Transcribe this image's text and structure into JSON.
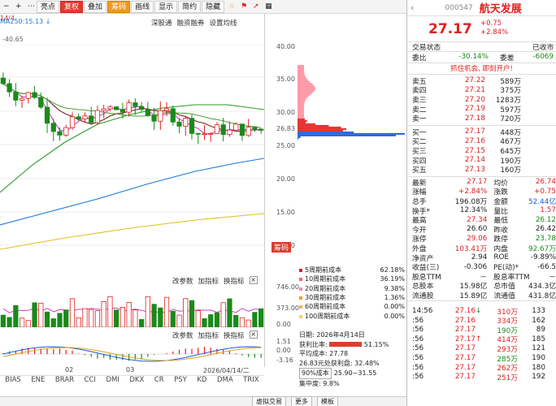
{
  "toolbar": {
    "buttons": [
      "亮点",
      "复权",
      "叠加",
      "筹码",
      "画线",
      "显示",
      "简约",
      "隐藏"
    ],
    "icons": [
      "minus-icon",
      "plus-icon",
      "dots-icon"
    ],
    "topright_icons": [
      "star-icon",
      "flag-icon",
      "arrow-icon",
      "grid-icon"
    ]
  },
  "chart": {
    "topline": "14/4",
    "ma250": "MA250:15.13 ↓",
    "price_low": "-40.65",
    "depth_links": [
      "深股通",
      "融资融券",
      "设置均线"
    ],
    "price_axis": [
      "40.00",
      "35.00",
      "30.00",
      "26.83",
      "25.00",
      "20.00",
      "15.00",
      "10.00"
    ],
    "chips_btn": "筹码",
    "vol_header": [
      "改参数",
      "加指标",
      "换指标"
    ],
    "vol_axis": [
      "746.00",
      "373.00",
      "0.00"
    ],
    "macd_header": [
      "改参数",
      "加指标",
      "换指标"
    ],
    "macd_axis": [
      "1.51",
      "0.00",
      "-3.16"
    ],
    "dates": [
      "02",
      "03",
      "2026/04/14/二"
    ],
    "tabs": [
      "BIAS",
      "ENE",
      "BRAR",
      "CCI",
      "DMI",
      "DKX",
      "CR",
      "PSY",
      "KD",
      "DMA",
      "TRIX"
    ],
    "bottom_buttons": [
      "虚拟交易",
      "更多",
      "模板"
    ]
  },
  "chips": {
    "legend": [
      {
        "label": "5周期前成本",
        "value": "62.18%",
        "color": "#e02020"
      },
      {
        "label": "10周期前成本",
        "value": "36.19%",
        "color": "#ff6070"
      },
      {
        "label": "20周期前成本",
        "value": "9.38%",
        "color": "#ff8a9a"
      },
      {
        "label": "30周期前成本",
        "value": "1.36%",
        "color": "#ff9a20"
      },
      {
        "label": "60周期前成本",
        "value": "0.00%",
        "color": "#ffb040"
      },
      {
        "label": "100周期前成本",
        "value": "0.00%",
        "color": "#ffd060"
      }
    ],
    "info": {
      "date": "日期: 2026年4月14日",
      "profit_label": "获利比率:",
      "profit": "51.15%",
      "avg_cost": "平均成本: 27.78",
      "profit_line": "26.83元处获利盘: 32.48%",
      "cost_sel": "90%成本",
      "cost_range": "25.90~31.55",
      "concentration": "集中度: 9.8%"
    }
  },
  "quote": {
    "code": "000547",
    "name": "航天发展",
    "price": "27.17",
    "chg": "+0.75",
    "pct": "+2.84%",
    "status_l": "交易状态",
    "status_r": "已收市",
    "weibi_l": "委比",
    "weibi_v": "-30.14%",
    "weicha_l": "委差",
    "weicha_v": "-6069",
    "promo": "抓住机会, 即刻开户!",
    "sells": [
      {
        "l": "卖五",
        "p": "27.22",
        "v": "589万"
      },
      {
        "l": "卖四",
        "p": "27.21",
        "v": "375万"
      },
      {
        "l": "卖三",
        "p": "27.20",
        "v": "1283万"
      },
      {
        "l": "卖二",
        "p": "27.19",
        "v": "597万"
      },
      {
        "l": "卖一",
        "p": "27.18",
        "v": "720万"
      }
    ],
    "buys": [
      {
        "l": "买一",
        "p": "27.17",
        "v": "448万"
      },
      {
        "l": "买二",
        "p": "27.16",
        "v": "467万"
      },
      {
        "l": "买三",
        "p": "27.15",
        "v": "645万"
      },
      {
        "l": "买四",
        "p": "27.14",
        "v": "190万"
      },
      {
        "l": "买五",
        "p": "27.13",
        "v": "160万"
      }
    ],
    "stats": [
      {
        "l1": "最新",
        "v1": "27.17",
        "c1": "red",
        "l2": "均价",
        "v2": "26.74",
        "c2": "red"
      },
      {
        "l1": "涨幅",
        "v1": "+2.84%",
        "c1": "red",
        "l2": "涨跌",
        "v2": "+0.75",
        "c2": "red"
      },
      {
        "l1": "总手",
        "v1": "196.08万",
        "c1": "",
        "l2": "金额",
        "v2": "52.44亿",
        "c2": "blue"
      },
      {
        "l1": "换手*",
        "v1": "12.34%",
        "c1": "",
        "l2": "量比",
        "v2": "1.57",
        "c2": "red"
      },
      {
        "l1": "最高",
        "v1": "27.34",
        "c1": "red",
        "l2": "最低",
        "v2": "26.12",
        "c2": "green"
      },
      {
        "l1": "今开",
        "v1": "26.60",
        "c1": "",
        "l2": "昨收",
        "v2": "26.42",
        "c2": ""
      },
      {
        "l1": "涨停",
        "v1": "29.06",
        "c1": "red",
        "l2": "跌停",
        "v2": "23.78",
        "c2": "green"
      },
      {
        "l1": "外盘",
        "v1": "103.41万",
        "c1": "red",
        "l2": "内盘",
        "v2": "92.67万",
        "c2": "green"
      },
      {
        "l1": "净资产",
        "v1": "2.94",
        "c1": "",
        "l2": "ROE",
        "v2": "-9.89%",
        "c2": ""
      },
      {
        "l1": "收益(三)",
        "v1": "-0.306",
        "c1": "",
        "l2": "PE(动)*",
        "v2": "-66.5",
        "c2": ""
      },
      {
        "l1": "股息TTM",
        "v1": "－",
        "c1": "",
        "l2": "股息率TTM",
        "v2": "－",
        "c2": ""
      },
      {
        "l1": "总股本",
        "v1": "15.98亿",
        "c1": "",
        "l2": "总市值",
        "v2": "434.3亿",
        "c2": ""
      },
      {
        "l1": "流通股",
        "v1": "15.89亿",
        "c1": "",
        "l2": "流通值",
        "v2": "431.8亿",
        "c2": ""
      }
    ],
    "ticks": [
      {
        "t": "14:56",
        "p": "27.16",
        "a": "↓",
        "v": "310万",
        "n": "133"
      },
      {
        "t": ":56",
        "p": "27.16",
        "a": "",
        "v": "334万",
        "n": "162"
      },
      {
        "t": ":56",
        "p": "27.17",
        "a": "",
        "v": "190万",
        "n": "89"
      },
      {
        "t": ":56",
        "p": "27.17",
        "a": "↑",
        "v": "414万",
        "n": "185"
      },
      {
        "t": ":56",
        "p": "27.17",
        "a": "",
        "v": "293万",
        "n": "121"
      },
      {
        "t": ":56",
        "p": "27.17",
        "a": "",
        "v": "285万",
        "n": "190"
      },
      {
        "t": ":56",
        "p": "27.17",
        "a": "",
        "v": "262万",
        "n": "180"
      },
      {
        "t": ":56",
        "p": "27.17",
        "a": "",
        "v": "251万",
        "n": "192"
      }
    ]
  }
}
